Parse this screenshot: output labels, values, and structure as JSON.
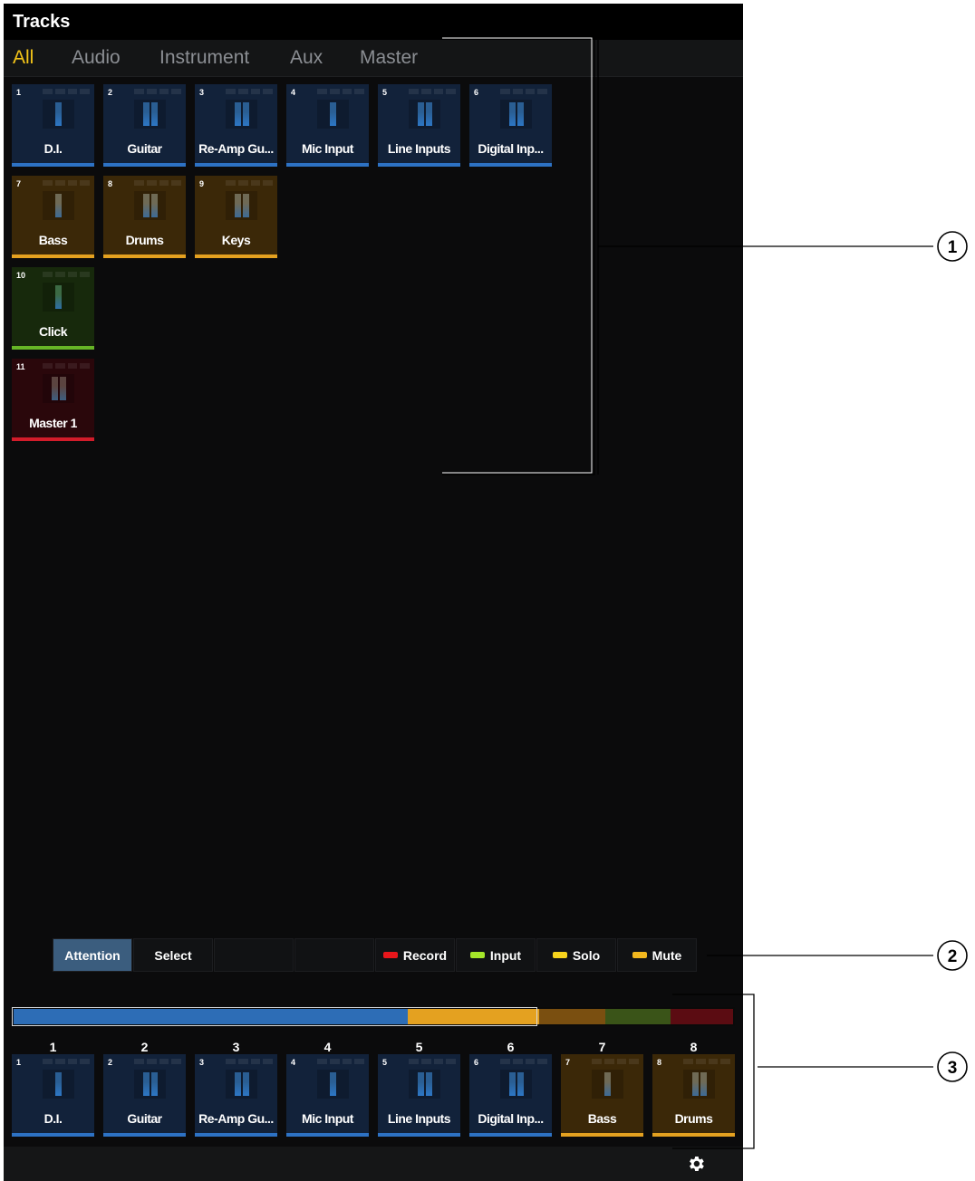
{
  "window": {
    "title": "Tracks"
  },
  "tabs": [
    {
      "label": "All",
      "active": true
    },
    {
      "label": "Audio",
      "active": false
    },
    {
      "label": "Instrument",
      "active": false
    },
    {
      "label": "Aux",
      "active": false
    },
    {
      "label": "Master",
      "active": false
    }
  ],
  "tracks": [
    {
      "num": "1",
      "name": "D.I.",
      "color": "blue",
      "channels": "mono"
    },
    {
      "num": "2",
      "name": "Guitar",
      "color": "blue",
      "channels": "stereo"
    },
    {
      "num": "3",
      "name": "Re-Amp Gu...",
      "color": "blue",
      "channels": "stereo"
    },
    {
      "num": "4",
      "name": "Mic Input",
      "color": "blue",
      "channels": "mono"
    },
    {
      "num": "5",
      "name": "Line Inputs",
      "color": "blue",
      "channels": "stereo"
    },
    {
      "num": "6",
      "name": "Digital Inp...",
      "color": "blue",
      "channels": "stereo"
    },
    {
      "num": "7",
      "name": "Bass",
      "color": "orange",
      "channels": "mono"
    },
    {
      "num": "8",
      "name": "Drums",
      "color": "orange",
      "channels": "stereo"
    },
    {
      "num": "9",
      "name": "Keys",
      "color": "orange",
      "channels": "stereo"
    },
    {
      "num": "10",
      "name": "Click",
      "color": "green",
      "channels": "mono"
    },
    {
      "num": "11",
      "name": "Master 1",
      "color": "red",
      "channels": "stereo"
    }
  ],
  "mode_buttons": [
    {
      "label": "Attention",
      "active": true,
      "swatch": null
    },
    {
      "label": "Select",
      "active": false,
      "swatch": null
    },
    {
      "label": "",
      "active": false,
      "swatch": null
    },
    {
      "label": "",
      "active": false,
      "swatch": null
    },
    {
      "label": "Record",
      "active": false,
      "swatch": "#e8161b"
    },
    {
      "label": "Input",
      "active": false,
      "swatch": "#a5e62a"
    },
    {
      "label": "Solo",
      "active": false,
      "swatch": "#f7d31c"
    },
    {
      "label": "Mute",
      "active": false,
      "swatch": "#f2b71e"
    }
  ],
  "bank_overview": {
    "colors": [
      "#2d6db6",
      "#2d6db6",
      "#2d6db6",
      "#2d6db6",
      "#2d6db6",
      "#2d6db6",
      "#e4a120",
      "#e4a120",
      "#7a4f10",
      "#3a5418",
      "#5b0c12"
    ]
  },
  "bank_numbers": [
    "1",
    "2",
    "3",
    "4",
    "5",
    "6",
    "7",
    "8"
  ],
  "bank_tracks": [
    {
      "num": "1",
      "name": "D.I.",
      "color": "blue",
      "channels": "mono"
    },
    {
      "num": "2",
      "name": "Guitar",
      "color": "blue",
      "channels": "stereo"
    },
    {
      "num": "3",
      "name": "Re-Amp Gu...",
      "color": "blue",
      "channels": "stereo"
    },
    {
      "num": "4",
      "name": "Mic Input",
      "color": "blue",
      "channels": "mono"
    },
    {
      "num": "5",
      "name": "Line Inputs",
      "color": "blue",
      "channels": "stereo"
    },
    {
      "num": "6",
      "name": "Digital Inp...",
      "color": "blue",
      "channels": "stereo"
    },
    {
      "num": "7",
      "name": "Bass",
      "color": "orange",
      "channels": "mono"
    },
    {
      "num": "8",
      "name": "Drums",
      "color": "orange",
      "channels": "stereo"
    }
  ],
  "footer": {
    "icon": "gear-icon"
  },
  "callouts": [
    "1",
    "2",
    "3"
  ]
}
